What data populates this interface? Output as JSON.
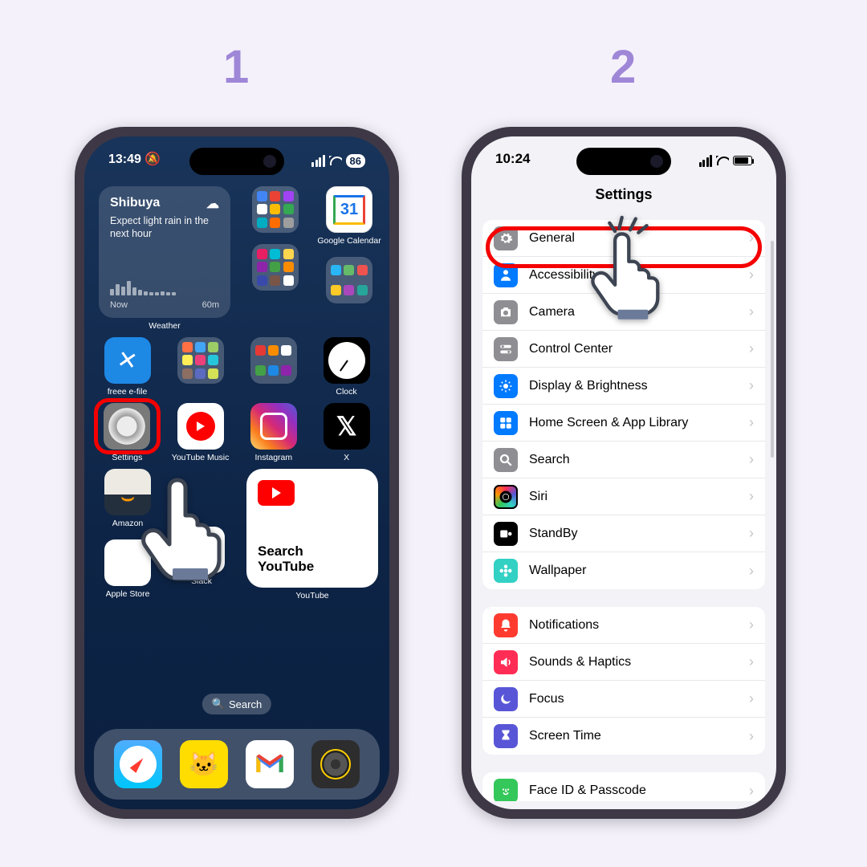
{
  "steps": {
    "one": "1",
    "two": "2"
  },
  "left": {
    "time": "13:49",
    "battery": "86",
    "weather": {
      "location": "Shibuya",
      "desc": "Expect light rain in the next hour",
      "foot_left": "Now",
      "foot_right": "60m",
      "label": "Weather"
    },
    "apps": {
      "gcal_num": "31",
      "gcal": "Google Calendar",
      "clock": "Clock",
      "freee": "freee e-file",
      "settings": "Settings",
      "ytmusic": "YouTube Music",
      "instagram": "Instagram",
      "x": "X",
      "amazon": "Amazon",
      "appstore": "Apple Store",
      "slack": "Slack",
      "youtube": "YouTube",
      "x_glyph": "𝕏"
    },
    "yt_widget_line1": "Search",
    "yt_widget_line2": "YouTube",
    "search_icon": "🔍",
    "search": "Search"
  },
  "right": {
    "time": "10:24",
    "title": "Settings",
    "group1": [
      {
        "label": "General",
        "icon": "gear",
        "cls": "ic-gray"
      },
      {
        "label": "Accessibility",
        "icon": "person",
        "cls": "ic-blue"
      },
      {
        "label": "Camera",
        "icon": "camera",
        "cls": "ic-gray"
      },
      {
        "label": "Control Center",
        "icon": "switches",
        "cls": "ic-gray"
      },
      {
        "label": "Display & Brightness",
        "icon": "sun",
        "cls": "ic-blue"
      },
      {
        "label": "Home Screen & App Library",
        "icon": "grid",
        "cls": "ic-blue"
      },
      {
        "label": "Search",
        "icon": "search",
        "cls": "ic-gray"
      },
      {
        "label": "Siri",
        "icon": "siri",
        "cls": "ic-siri"
      },
      {
        "label": "StandBy",
        "icon": "standby",
        "cls": "ic-standby"
      },
      {
        "label": "Wallpaper",
        "icon": "flower",
        "cls": "ic-teal"
      }
    ],
    "group2": [
      {
        "label": "Notifications",
        "icon": "bell",
        "cls": "ic-red"
      },
      {
        "label": "Sounds & Haptics",
        "icon": "speaker",
        "cls": "ic-pink"
      },
      {
        "label": "Focus",
        "icon": "moon",
        "cls": "ic-indigo"
      },
      {
        "label": "Screen Time",
        "icon": "timer",
        "cls": "ic-indigo"
      }
    ],
    "group3": [
      {
        "label": "Face ID & Passcode",
        "icon": "face",
        "cls": "ic-green"
      }
    ]
  }
}
